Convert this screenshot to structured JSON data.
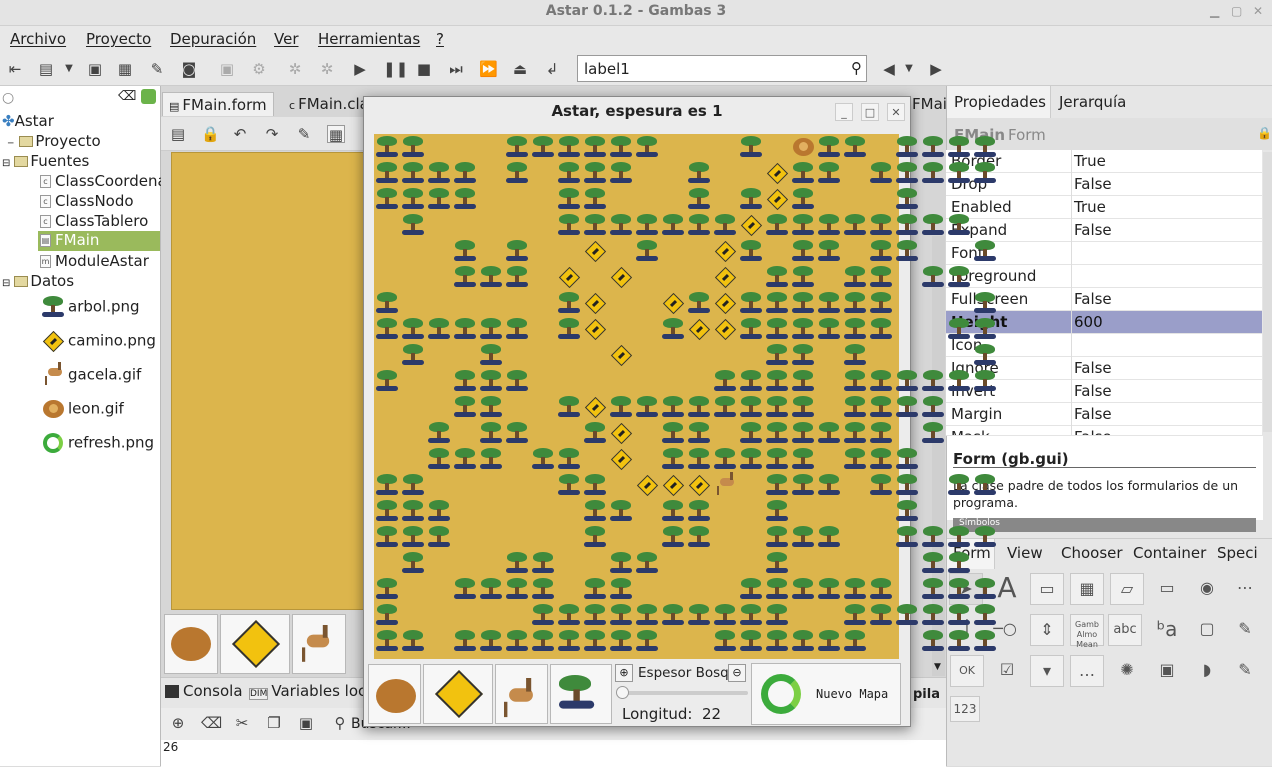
{
  "window": {
    "title": "Astar 0.1.2 - Gambas 3"
  },
  "menu": [
    "Archivo",
    "Proyecto",
    "Depuración",
    "Ver",
    "Herramientas",
    "?"
  ],
  "toolbar": {
    "search_value": "label1"
  },
  "project_tree": {
    "root": "Astar",
    "proyecto": "Proyecto",
    "fuentes": "Fuentes",
    "sources": [
      "ClassCoordena",
      "ClassNodo",
      "ClassTablero",
      "FMain",
      "ModuleAstar"
    ],
    "datos": "Datos",
    "data_files": [
      "arbol.png",
      "camino.png",
      "gacela.gif",
      "leon.gif",
      "refresh.png"
    ]
  },
  "editor_tabs": [
    "FMain.form",
    "FMain.cla",
    "FMain.cla"
  ],
  "bottom": {
    "console_tab": "Consola",
    "vars_tab": "Variables loca",
    "search_label": "Buscar...",
    "console_line": "26",
    "pila": "pila"
  },
  "dialog": {
    "title": "Astar, espesura es 1",
    "espesor_label": "Espesor Bosq",
    "slider_level": 0,
    "longitud_label": "Longitud:",
    "longitud_value": "22",
    "nuevo_mapa": "Nuevo Mapa"
  },
  "board_rows": [
    "TT...TTTTTT...T.LTT.TTTT",
    "TTTT.T.TTT..T..PTT.TTTTT",
    "TTTT...TT...T.TPT...T...",
    ".T.....TTTTTTTPTTTTTTTT.",
    "...T.T..P.T..PT.TT.TT..T",
    "...TTT.P.P...P.TT.TT.TT.",
    "T......TP..PTPTTTTTT...T",
    "TTTTTT.TP..TPPTTTTTT..TT",
    ".T..T....P.....TT.T....T",
    "T..TTT.......TTTT.TTTTTT",
    "...TT..TPTTTTTTTT.TTTT..",
    "..T.TT..TP.TT.TTTTTT.T..",
    "..TTT.TT.P.TTTTTT.TTT...",
    "TT.....TT.PPPG.TTT.TT.TT",
    "TTT.....TT.TT..T....T...",
    "TTT.....T..TT..TTT..TTTT",
    ".T...TT..TT....T.....TT.",
    "T..TTTT.TT....TTTTTT.TTT",
    "T.....TTTTTTTTTT..TTTTTT",
    "TT.TTTTTTTT..TTTTTT..TTT"
  ],
  "properties": {
    "header": "Propiedades",
    "jerarquia": "Jerarquía",
    "object": "FMain",
    "object_type": "Form",
    "rows": [
      {
        "name": "Border",
        "value": "True"
      },
      {
        "name": "Drop",
        "value": "False"
      },
      {
        "name": "Enabled",
        "value": "True"
      },
      {
        "name": "Expand",
        "value": "False"
      },
      {
        "name": "Font",
        "value": ""
      },
      {
        "name": "Foreground",
        "value": ""
      },
      {
        "name": "FullScreen",
        "value": "False"
      },
      {
        "name": "Height",
        "value": "600"
      },
      {
        "name": "Icon",
        "value": ""
      },
      {
        "name": "Ignore",
        "value": "False"
      },
      {
        "name": "Invert",
        "value": "False"
      },
      {
        "name": "Margin",
        "value": "False"
      },
      {
        "name": "Mask",
        "value": "False"
      }
    ],
    "help_title": "Form (gb.gui)",
    "help_text": "La clase padre de todos los formularios de un programa.",
    "symbols": "Símbolos"
  },
  "toolbox_tabs": [
    "Form",
    "View",
    "Chooser",
    "Container",
    "Speci"
  ],
  "toolbox": {
    "abc": "abc",
    "ok": "OK",
    "num": "123",
    "list_text": "Gamb Almo Mean"
  }
}
